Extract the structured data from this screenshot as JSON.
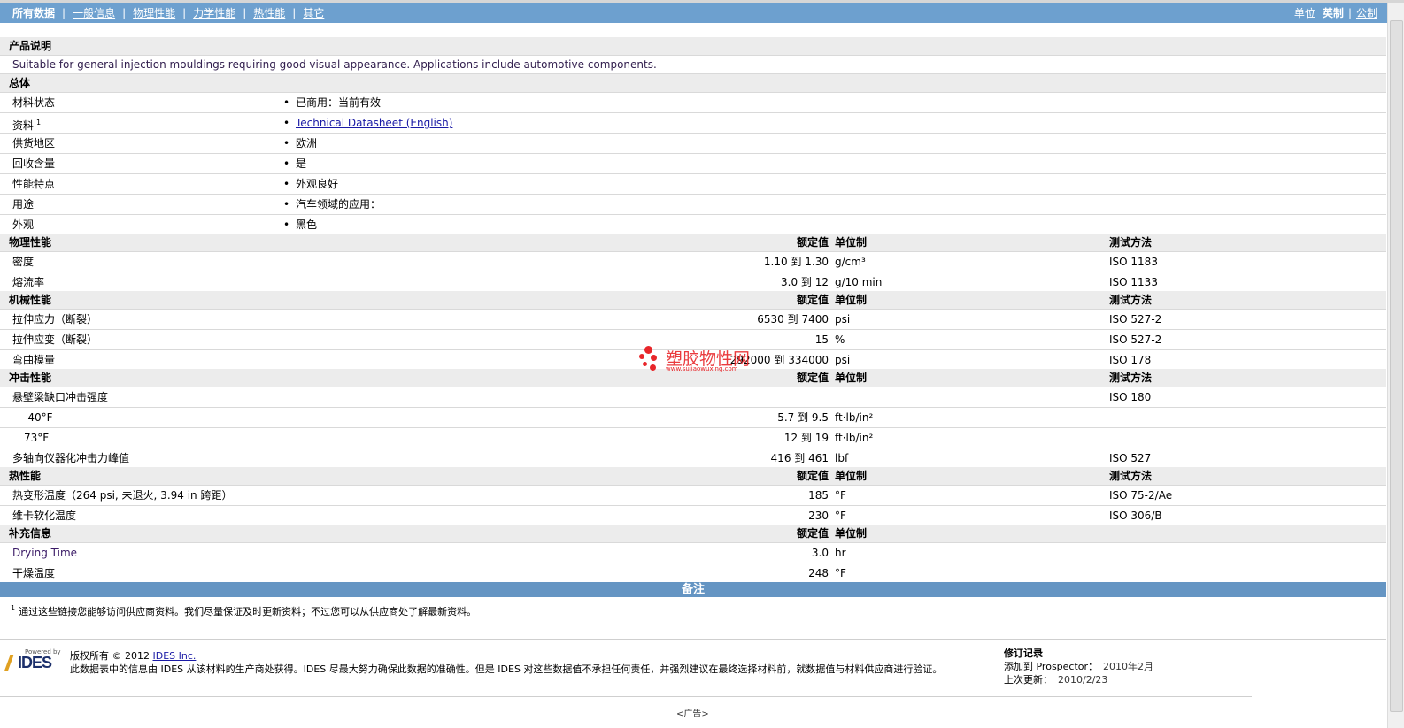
{
  "nav": {
    "items": [
      {
        "label": "所有数据",
        "active": true
      },
      {
        "label": "一般信息",
        "active": false
      },
      {
        "label": "物理性能",
        "active": false
      },
      {
        "label": "力学性能",
        "active": false
      },
      {
        "label": "热性能",
        "active": false
      },
      {
        "label": "其它",
        "active": false
      }
    ],
    "unit_label": "单位",
    "unit_english": "英制",
    "unit_sep": "|",
    "unit_metric": "公制"
  },
  "product": {
    "heading": "产品说明",
    "description": "Suitable for general injection mouldings requiring good visual appearance. Applications include automotive components."
  },
  "general": {
    "heading": "总体",
    "rows": [
      {
        "label": "材料状态",
        "value": "已商用：当前有效"
      },
      {
        "label": "资料",
        "sup": "1",
        "value": "Technical Datasheet (English)",
        "is_link": true
      },
      {
        "label": "供货地区",
        "value": "欧洲"
      },
      {
        "label": "回收含量",
        "value": "是"
      },
      {
        "label": "性能特点",
        "value": "外观良好"
      },
      {
        "label": "用途",
        "value": "汽车领域的应用："
      },
      {
        "label": "外观",
        "value": "黑色"
      }
    ]
  },
  "headers": {
    "nominal": "额定值",
    "unit": "单位制",
    "method": "测试方法"
  },
  "physical": {
    "heading": "物理性能",
    "rows": [
      {
        "label": "密度",
        "value": "1.10 到  1.30",
        "unit": "g/cm³",
        "method": "ISO 1183"
      },
      {
        "label": "熔流率",
        "value": "3.0 到  12",
        "unit": "g/10 min",
        "method": "ISO 1133"
      }
    ]
  },
  "mechanical": {
    "heading": "机械性能",
    "rows": [
      {
        "label": "拉伸应力（断裂）",
        "value": "6530 到  7400",
        "unit": "psi",
        "method": "ISO 527-2"
      },
      {
        "label": "拉伸应变（断裂）",
        "value": "15",
        "unit": "%",
        "method": "ISO 527-2"
      },
      {
        "label": "弯曲模量",
        "value": "292000 到  334000",
        "unit": "psi",
        "method": "ISO 178"
      }
    ]
  },
  "impact": {
    "heading": "冲击性能",
    "rows": [
      {
        "label": "悬壁梁缺口冲击强度",
        "value": "",
        "unit": "",
        "method": "ISO 180",
        "indent": false
      },
      {
        "label": "-40°F",
        "value": "5.7 到  9.5",
        "unit": "ft·lb/in²",
        "method": "",
        "indent": true
      },
      {
        "label": "73°F",
        "value": "12 到  19",
        "unit": "ft·lb/in²",
        "method": "",
        "indent": true
      },
      {
        "label": "多轴向仪器化冲击力峰值",
        "value": "416 到  461",
        "unit": "lbf",
        "method": "ISO 527",
        "indent": false
      }
    ]
  },
  "thermal": {
    "heading": "热性能",
    "rows": [
      {
        "label": "热变形温度（264 psi, 未退火, 3.94 in 跨距）",
        "value": "185",
        "unit": "°F",
        "method": "ISO 75-2/Ae"
      },
      {
        "label": "维卡软化温度",
        "value": "230",
        "unit": "°F",
        "method": "ISO 306/B"
      }
    ]
  },
  "supplement": {
    "heading": "补充信息",
    "rows": [
      {
        "label": "Drying Time",
        "value": "3.0",
        "unit": "hr",
        "method": ""
      },
      {
        "label": "干燥温度",
        "value": "248",
        "unit": "°F",
        "method": ""
      }
    ]
  },
  "notes": {
    "title": "备注",
    "footnote_mark": "1",
    "footnote": "通过这些链接您能够访问供应商资料。我们尽量保证及时更新资料；不过您可以从供应商处了解最新资料。"
  },
  "footer": {
    "logo_powered": "Powered by",
    "logo_text": "IDES",
    "copyright_prefix": "版权所有 © 2012 ",
    "copyright_link": "IDES Inc.",
    "disclaimer": "此数据表中的信息由 IDES 从该材料的生产商处获得。IDES 尽最大努力确保此数据的准确性。但是 IDES 对这些数据值不承担任何责任，并强烈建议在最终选择材料前，就数据值与材料供应商进行验证。",
    "rev_title": "修订记录",
    "added_label": "添加到 Prospector：",
    "added_value": "2010年2月",
    "updated_label": "上次更新：",
    "updated_value": "2010/2/23",
    "ad": "<广告>"
  },
  "watermark": {
    "text": "塑胶物性网",
    "url": "www.sujiaowuxing.com"
  }
}
